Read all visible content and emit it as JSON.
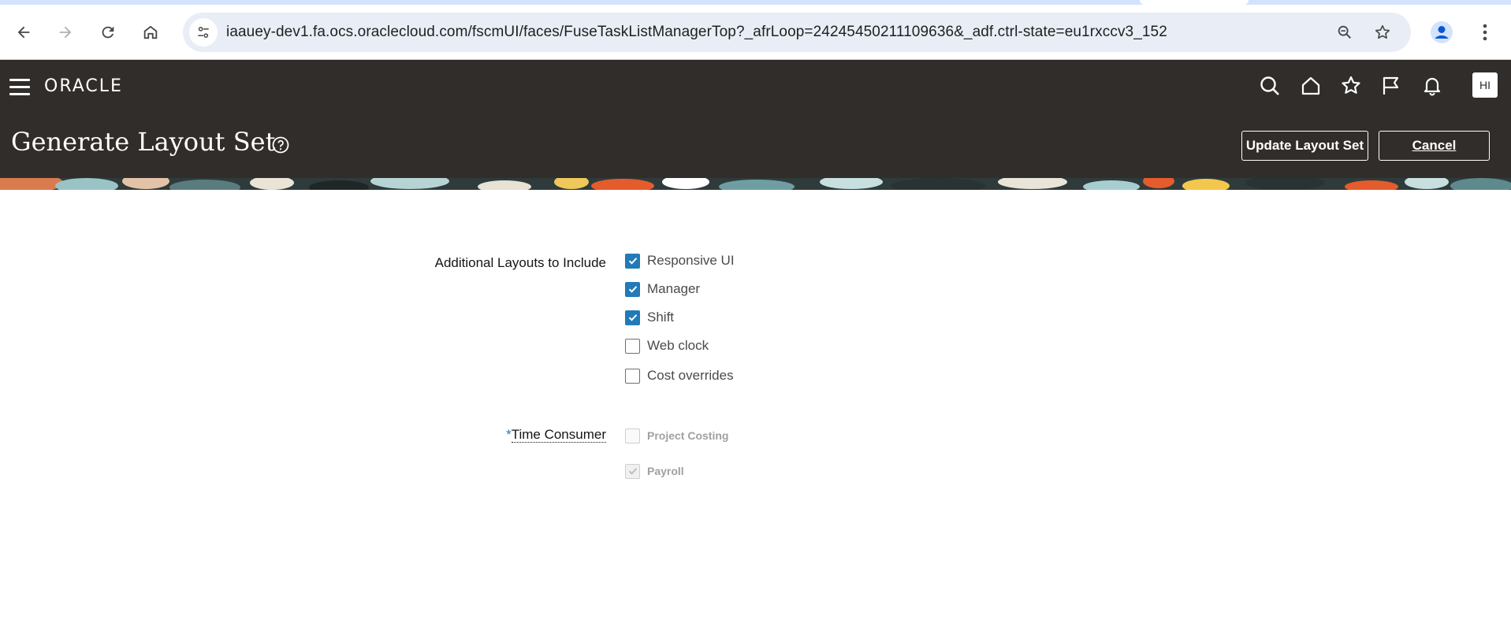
{
  "browser": {
    "url": "iaauey-dev1.fa.ocs.oraclecloud.com/fscmUI/faces/FuseTaskListManagerTop?_afrLoop=24245450211109636&_adf.ctrl-state=eu1rxccv3_152",
    "icons": {
      "back": "back-arrow-icon",
      "forward": "forward-arrow-icon",
      "reload": "reload-icon",
      "home": "home-icon",
      "site_info": "tune-icon",
      "zoom": "zoom-icon",
      "bookmark": "star-icon",
      "profile": "profile-icon",
      "menu": "kebab-menu-icon"
    }
  },
  "header": {
    "logo_text": "ORACLE",
    "user_initials": "HI",
    "page_title": "Generate Layout Set",
    "update_button": "Update Layout Set",
    "cancel_button": "Cancel",
    "colors": {
      "header_bg": "#312d2a",
      "accent": "#227ab8"
    }
  },
  "form": {
    "layouts_label": "Additional Layouts to Include",
    "layouts": [
      {
        "label": "Responsive UI",
        "checked": true
      },
      {
        "label": "Manager",
        "checked": true
      },
      {
        "label": "Shift",
        "checked": true
      },
      {
        "label": "Web clock",
        "checked": false
      },
      {
        "label": "Cost overrides",
        "checked": false
      }
    ],
    "time_consumer_required": "*",
    "time_consumer_label": "Time Consumer",
    "time_consumers": [
      {
        "label": "Project Costing",
        "checked": false,
        "disabled": true
      },
      {
        "label": "Payroll",
        "checked": true,
        "disabled": true
      }
    ]
  }
}
